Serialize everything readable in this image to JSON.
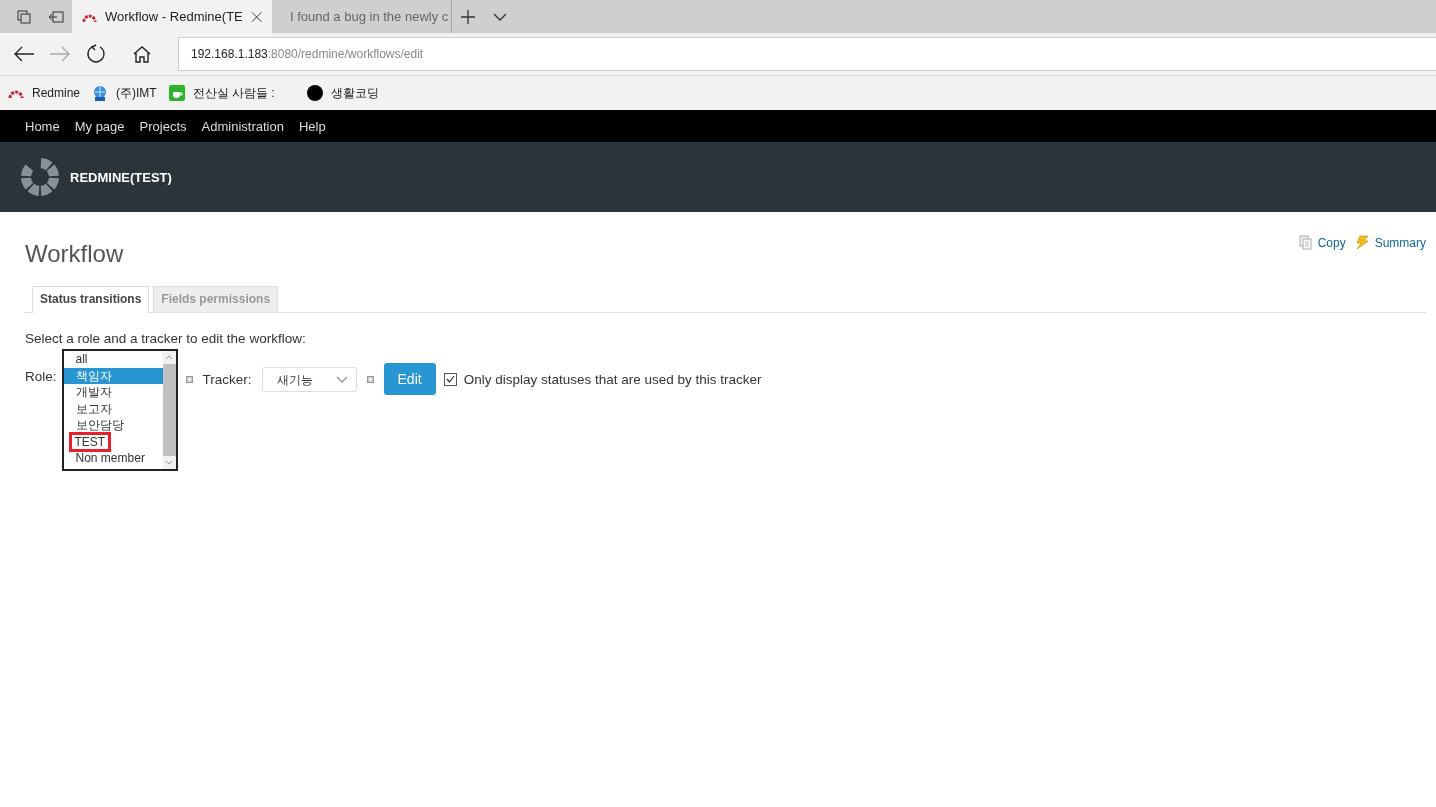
{
  "browser": {
    "tabs": [
      {
        "title": "Workflow - Redmine(TE",
        "selected": true,
        "kind": "redmine"
      },
      {
        "title": "I found a bug in the newly c",
        "selected": false,
        "kind": "page"
      }
    ],
    "address": {
      "host": "192.168.1.183",
      "rest": ":8080/redmine/workflows/edit"
    },
    "bookmarks": [
      {
        "label": "Redmine",
        "kind": "redmine"
      },
      {
        "label": "(주)IMT",
        "kind": "globe"
      },
      {
        "label": "전산실 사람들 :",
        "kind": "cup"
      },
      {
        "label": "생활코딩",
        "kind": "dot"
      }
    ]
  },
  "top_menu": [
    "Home",
    "My page",
    "Projects",
    "Administration",
    "Help"
  ],
  "header": {
    "title": "REDMINE(TEST)"
  },
  "page": {
    "title": "Workflow",
    "actions": [
      {
        "label": "Copy",
        "kind": "copy"
      },
      {
        "label": "Summary",
        "kind": "summary"
      }
    ],
    "tabs": [
      {
        "label": "Status transitions",
        "selected": true
      },
      {
        "label": "Fields permissions",
        "selected": false
      }
    ],
    "instruction": "Select a role and a tracker to edit the workflow:",
    "role_label": "Role:",
    "roles": [
      {
        "label": "all",
        "selected": false,
        "highlighted": false
      },
      {
        "label": "책임자",
        "selected": true,
        "highlighted": false
      },
      {
        "label": "개발자",
        "selected": false,
        "highlighted": false
      },
      {
        "label": "보고자",
        "selected": false,
        "highlighted": false
      },
      {
        "label": "보안담당",
        "selected": false,
        "highlighted": false
      },
      {
        "label": "TEST",
        "selected": false,
        "highlighted": true
      },
      {
        "label": "Non member",
        "selected": false,
        "highlighted": false
      }
    ],
    "tracker_label": "Tracker:",
    "tracker_value": "새기능",
    "edit_button": "Edit",
    "only_used": {
      "label": "Only display statuses that are used by this tracker",
      "checked": true
    }
  }
}
